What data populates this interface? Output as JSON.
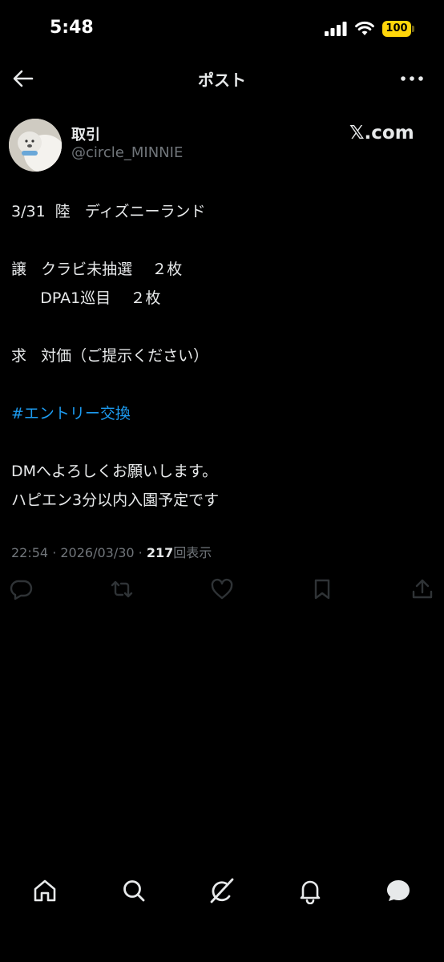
{
  "status_bar": {
    "time": "5:48",
    "battery_level": "100",
    "icons": [
      "cellular-signal-icon",
      "wifi-icon",
      "battery-icon"
    ],
    "battery_color": "#ffd60a"
  },
  "header": {
    "title": "ポスト",
    "back_icon": "arrow-left-icon",
    "more_icon": "more-horizontal-icon"
  },
  "author": {
    "name": "取引",
    "handle": "@circle_MINNIE",
    "source_label": "𝕏.com"
  },
  "post": {
    "lines": [
      "3/31  陸   ディズニーランド",
      "",
      "譲   クラビ未抽選    ２枚",
      "      DPA1巡目    ２枚",
      "",
      "求   対価（ご提示ください）",
      "",
      "#エントリー交換",
      "",
      "DMへよろしくお願いします。",
      "ハピエン3分以内入園予定です"
    ],
    "hashtag": "#エントリー交換",
    "hashtag_color": "#1d9bf0",
    "timestamp": "22:54 · 2026/03/30 · ",
    "views": "217",
    "views_label": "回表示"
  },
  "actions": [
    {
      "name": "reply-icon"
    },
    {
      "name": "repost-icon"
    },
    {
      "name": "like-icon"
    },
    {
      "name": "bookmark-icon"
    },
    {
      "name": "share-icon"
    }
  ],
  "bottom_nav": [
    {
      "name": "home-icon"
    },
    {
      "name": "search-icon"
    },
    {
      "name": "grok-icon"
    },
    {
      "name": "notifications-icon"
    },
    {
      "name": "messages-icon"
    }
  ],
  "colors": {
    "background": "#000000",
    "text": "#e7e9ea",
    "secondary": "#71767b",
    "action_icon": "#2f3336"
  }
}
